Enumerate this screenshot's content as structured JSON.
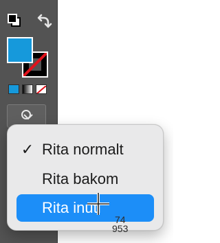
{
  "colors": {
    "toolbar": "#535353",
    "fill_color": "#1699db",
    "stroke_color": "#ffffff",
    "none_slash": "#e0121b",
    "menu_background": "#e9e9ea",
    "menu_highlight": "#1c8ef8"
  },
  "toolbar": {
    "default_colors_icon": "default-fill-stroke",
    "swap_icon": "swap-fill-stroke",
    "fill_swatch_color": "#1699db",
    "stroke_swatch": "none",
    "modes": [
      "color",
      "gradient",
      "none"
    ],
    "fill_tool_icon": "paint-bucket"
  },
  "menu": {
    "items": [
      {
        "label": "Rita normalt",
        "checked": "✓"
      },
      {
        "label": "Rita bakom",
        "checked": ""
      },
      {
        "label": "Rita inuti",
        "checked": ""
      }
    ],
    "highlighted_index": 2
  },
  "cursor": {
    "icon": "crosshair",
    "readout_line_1": "74",
    "readout_line_2": "953"
  }
}
